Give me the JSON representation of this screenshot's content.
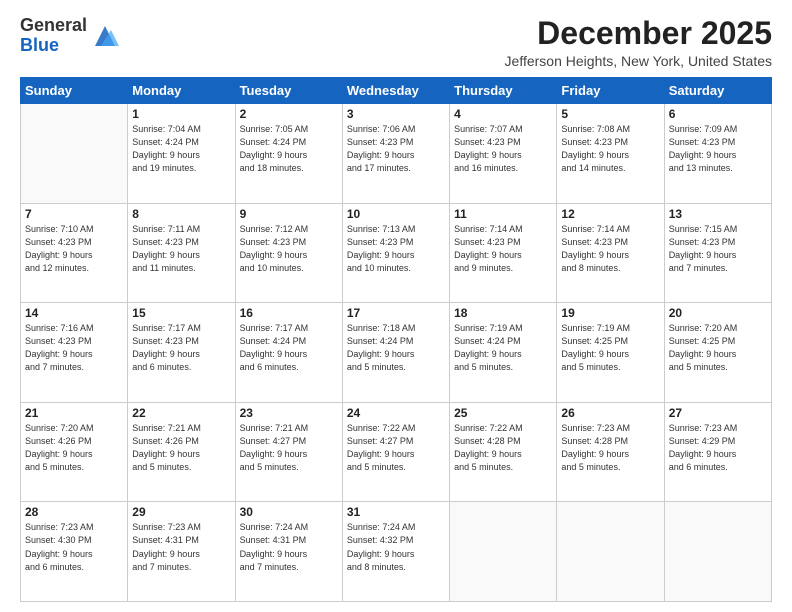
{
  "logo": {
    "line1": "General",
    "line2": "Blue"
  },
  "title": "December 2025",
  "location": "Jefferson Heights, New York, United States",
  "days_header": [
    "Sunday",
    "Monday",
    "Tuesday",
    "Wednesday",
    "Thursday",
    "Friday",
    "Saturday"
  ],
  "weeks": [
    [
      {
        "day": "",
        "info": ""
      },
      {
        "day": "1",
        "info": "Sunrise: 7:04 AM\nSunset: 4:24 PM\nDaylight: 9 hours\nand 19 minutes."
      },
      {
        "day": "2",
        "info": "Sunrise: 7:05 AM\nSunset: 4:24 PM\nDaylight: 9 hours\nand 18 minutes."
      },
      {
        "day": "3",
        "info": "Sunrise: 7:06 AM\nSunset: 4:23 PM\nDaylight: 9 hours\nand 17 minutes."
      },
      {
        "day": "4",
        "info": "Sunrise: 7:07 AM\nSunset: 4:23 PM\nDaylight: 9 hours\nand 16 minutes."
      },
      {
        "day": "5",
        "info": "Sunrise: 7:08 AM\nSunset: 4:23 PM\nDaylight: 9 hours\nand 14 minutes."
      },
      {
        "day": "6",
        "info": "Sunrise: 7:09 AM\nSunset: 4:23 PM\nDaylight: 9 hours\nand 13 minutes."
      }
    ],
    [
      {
        "day": "7",
        "info": "Sunrise: 7:10 AM\nSunset: 4:23 PM\nDaylight: 9 hours\nand 12 minutes."
      },
      {
        "day": "8",
        "info": "Sunrise: 7:11 AM\nSunset: 4:23 PM\nDaylight: 9 hours\nand 11 minutes."
      },
      {
        "day": "9",
        "info": "Sunrise: 7:12 AM\nSunset: 4:23 PM\nDaylight: 9 hours\nand 10 minutes."
      },
      {
        "day": "10",
        "info": "Sunrise: 7:13 AM\nSunset: 4:23 PM\nDaylight: 9 hours\nand 10 minutes."
      },
      {
        "day": "11",
        "info": "Sunrise: 7:14 AM\nSunset: 4:23 PM\nDaylight: 9 hours\nand 9 minutes."
      },
      {
        "day": "12",
        "info": "Sunrise: 7:14 AM\nSunset: 4:23 PM\nDaylight: 9 hours\nand 8 minutes."
      },
      {
        "day": "13",
        "info": "Sunrise: 7:15 AM\nSunset: 4:23 PM\nDaylight: 9 hours\nand 7 minutes."
      }
    ],
    [
      {
        "day": "14",
        "info": "Sunrise: 7:16 AM\nSunset: 4:23 PM\nDaylight: 9 hours\nand 7 minutes."
      },
      {
        "day": "15",
        "info": "Sunrise: 7:17 AM\nSunset: 4:23 PM\nDaylight: 9 hours\nand 6 minutes."
      },
      {
        "day": "16",
        "info": "Sunrise: 7:17 AM\nSunset: 4:24 PM\nDaylight: 9 hours\nand 6 minutes."
      },
      {
        "day": "17",
        "info": "Sunrise: 7:18 AM\nSunset: 4:24 PM\nDaylight: 9 hours\nand 5 minutes."
      },
      {
        "day": "18",
        "info": "Sunrise: 7:19 AM\nSunset: 4:24 PM\nDaylight: 9 hours\nand 5 minutes."
      },
      {
        "day": "19",
        "info": "Sunrise: 7:19 AM\nSunset: 4:25 PM\nDaylight: 9 hours\nand 5 minutes."
      },
      {
        "day": "20",
        "info": "Sunrise: 7:20 AM\nSunset: 4:25 PM\nDaylight: 9 hours\nand 5 minutes."
      }
    ],
    [
      {
        "day": "21",
        "info": "Sunrise: 7:20 AM\nSunset: 4:26 PM\nDaylight: 9 hours\nand 5 minutes."
      },
      {
        "day": "22",
        "info": "Sunrise: 7:21 AM\nSunset: 4:26 PM\nDaylight: 9 hours\nand 5 minutes."
      },
      {
        "day": "23",
        "info": "Sunrise: 7:21 AM\nSunset: 4:27 PM\nDaylight: 9 hours\nand 5 minutes."
      },
      {
        "day": "24",
        "info": "Sunrise: 7:22 AM\nSunset: 4:27 PM\nDaylight: 9 hours\nand 5 minutes."
      },
      {
        "day": "25",
        "info": "Sunrise: 7:22 AM\nSunset: 4:28 PM\nDaylight: 9 hours\nand 5 minutes."
      },
      {
        "day": "26",
        "info": "Sunrise: 7:23 AM\nSunset: 4:28 PM\nDaylight: 9 hours\nand 5 minutes."
      },
      {
        "day": "27",
        "info": "Sunrise: 7:23 AM\nSunset: 4:29 PM\nDaylight: 9 hours\nand 6 minutes."
      }
    ],
    [
      {
        "day": "28",
        "info": "Sunrise: 7:23 AM\nSunset: 4:30 PM\nDaylight: 9 hours\nand 6 minutes."
      },
      {
        "day": "29",
        "info": "Sunrise: 7:23 AM\nSunset: 4:31 PM\nDaylight: 9 hours\nand 7 minutes."
      },
      {
        "day": "30",
        "info": "Sunrise: 7:24 AM\nSunset: 4:31 PM\nDaylight: 9 hours\nand 7 minutes."
      },
      {
        "day": "31",
        "info": "Sunrise: 7:24 AM\nSunset: 4:32 PM\nDaylight: 9 hours\nand 8 minutes."
      },
      {
        "day": "",
        "info": ""
      },
      {
        "day": "",
        "info": ""
      },
      {
        "day": "",
        "info": ""
      }
    ]
  ]
}
